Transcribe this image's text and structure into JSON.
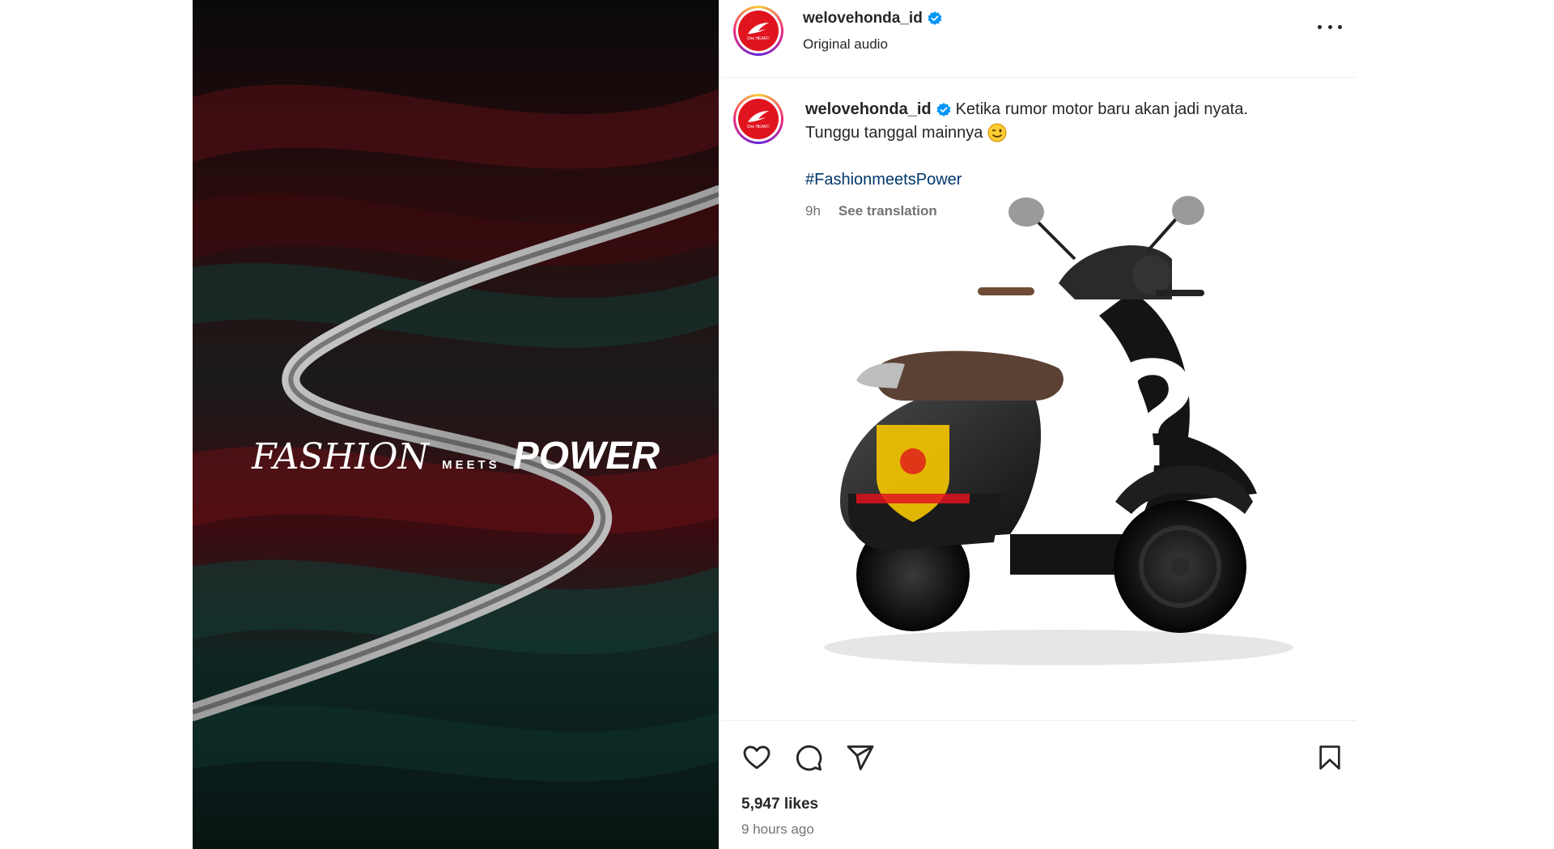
{
  "media": {
    "tagline_fashion": "FASHION",
    "tagline_meets": "MEETS",
    "tagline_power": "POWER"
  },
  "header": {
    "username": "welovehonda_id",
    "audio": "Original audio"
  },
  "avatar": {
    "text": "One HEART."
  },
  "caption": {
    "username": "welovehonda_id",
    "line1": "Ketika rumor motor baru akan jadi nyata.",
    "line2": "Tunggu tanggal mainnya",
    "hashtag": "#FashionmeetsPower",
    "time_short": "9h",
    "see_translation": "See translation"
  },
  "post_image": {
    "overlay_symbol": "?"
  },
  "actions": {
    "icons": [
      "heart-icon",
      "comment-icon",
      "share-icon",
      "bookmark-icon"
    ]
  },
  "footer": {
    "likes": "5,947 likes",
    "time_ago": "9 hours ago"
  },
  "colors": {
    "honda_red": "#e0141e",
    "verified_blue": "#0095f6",
    "hashtag_blue": "#00376b",
    "muted_grey": "#737373"
  }
}
